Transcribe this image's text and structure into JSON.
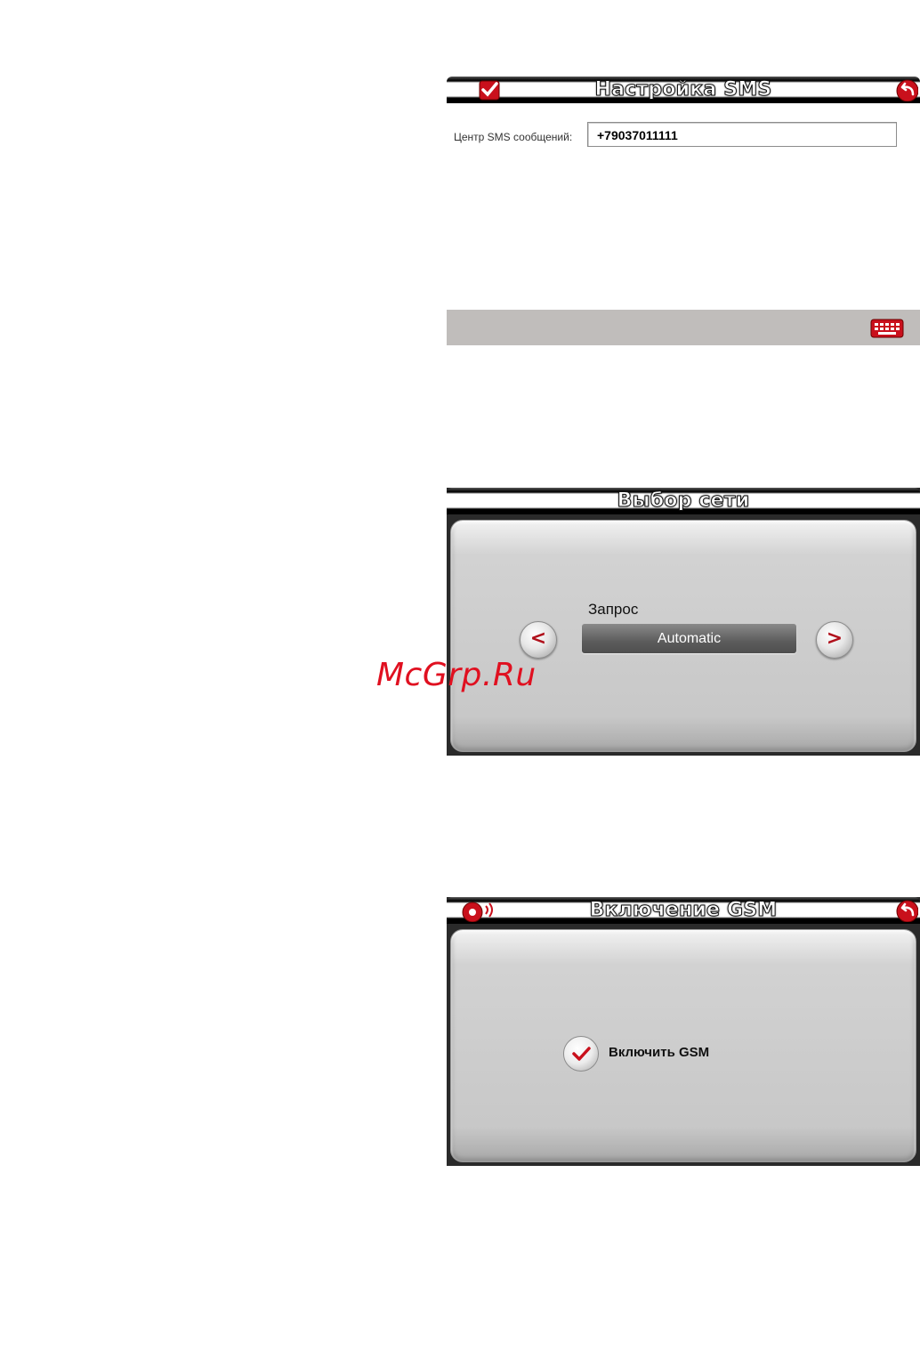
{
  "sms_settings": {
    "title": "Настройка SMS",
    "field_label": "Центр SMS сообщений:",
    "field_value": "+79037011111",
    "icons": [
      "checkmark-icon",
      "back-arrow-icon",
      "keyboard-icon"
    ]
  },
  "network_selection": {
    "title": "Выбор сети",
    "mode_label": "Запрос",
    "mode_value": "Automatic",
    "prev_glyph": "<",
    "next_glyph": ">"
  },
  "gsm_enable": {
    "title": "Включение GSM",
    "checkbox_label": "Включить GSM",
    "checkbox_checked": true,
    "icons": [
      "antenna-icon",
      "back-arrow-icon"
    ]
  },
  "watermark": "McGrp.Ru",
  "colors": {
    "accent": "#c8101e",
    "titlebar": "#000000",
    "panel": "#cccccc",
    "toolbar": "#c0bdbb"
  }
}
